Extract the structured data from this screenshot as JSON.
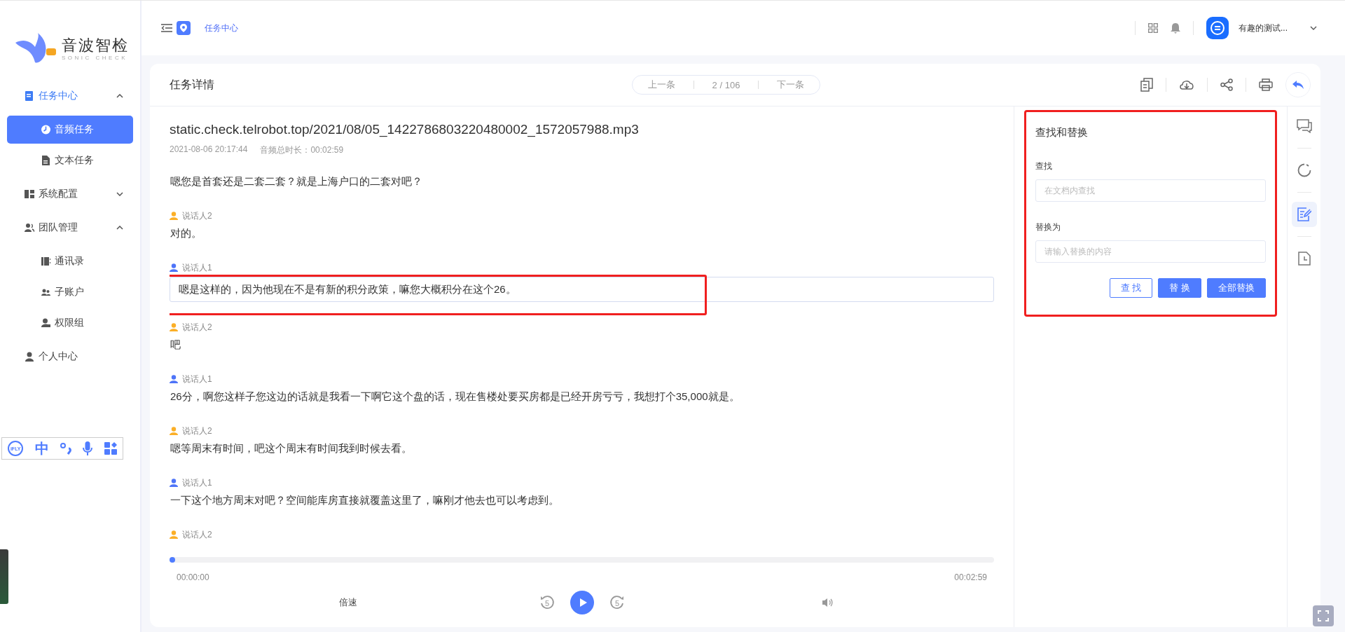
{
  "sidebar": {
    "logo": {
      "name": "音波智检",
      "tagline": "SONIC CHECK"
    },
    "menu": [
      {
        "label": "任务中心",
        "expanded": true,
        "children": [
          {
            "label": "音频任务",
            "selected": true
          },
          {
            "label": "文本任务",
            "selected": false
          }
        ]
      },
      {
        "label": "系统配置",
        "expanded": false
      },
      {
        "label": "团队管理",
        "expanded": true,
        "children": [
          {
            "label": "通讯录",
            "selected": false
          },
          {
            "label": "子账户",
            "selected": false
          },
          {
            "label": "权限组",
            "selected": false
          }
        ]
      },
      {
        "label": "个人中心"
      }
    ]
  },
  "ime_toolbar": {
    "logo": "iFLY",
    "mode": "中"
  },
  "header": {
    "breadcrumb": "任务中心",
    "user": "有趣的测试..."
  },
  "card": {
    "title": "任务详情",
    "pager": {
      "prev": "上一条",
      "position": "2 / 106",
      "next": "下一条"
    }
  },
  "file": {
    "name": "static.check.telrobot.top/2021/08/05_1422786803220480002_1572057988.mp3",
    "date": "2021-08-06 20:17:44",
    "duration": "音频总时长：00:02:59"
  },
  "segments": [
    {
      "text": "嗯您是首套还是二套二套？就是上海户口的二套对吧？",
      "selected": false
    },
    {
      "speaker": "说话人2",
      "color": "#fbaf27",
      "text": "对的。",
      "selected": false
    },
    {
      "speaker": "说话人1",
      "color": "#4e74f8",
      "text": "嗯是这样的，因为他现在不是有新的积分政策，嘛您大概积分在这个26。",
      "selected": true,
      "annotated": true
    },
    {
      "speaker": "说话人2",
      "color": "#fbaf27",
      "text": "吧",
      "selected": false
    },
    {
      "speaker": "说话人1",
      "color": "#4e74f8",
      "text": "26分，啊您这样子您这边的话就是我看一下啊它这个盘的话，现在售楼处要买房都是已经开房亏亏，我想打个35,000就是。",
      "selected": false
    },
    {
      "speaker": "说话人2",
      "color": "#fbaf27",
      "text": "嗯等周末有时间，吧这个周末有时间我到时候去看。",
      "selected": false
    },
    {
      "speaker": "说话人1",
      "color": "#4e74f8",
      "text": "一下这个地方周末对吧？空间能库房直接就覆盖这里了，嘛刚才他去也可以考虑到。",
      "selected": false
    },
    {
      "speaker": "说话人2",
      "color": "#fbaf27"
    }
  ],
  "player": {
    "level": 0,
    "current": "00:00:00",
    "total": "00:02:59",
    "speed": "倍速",
    "skip_back": "5",
    "skip_forward": "5"
  },
  "find_replace": {
    "annotated": true,
    "title": "查找和替换",
    "find_label": "查找",
    "find_placeholder": "在文档内查找",
    "replace_label": "替换为",
    "replace_placeholder": "请输入替换的内容",
    "buttons": [
      {
        "label": "查 找",
        "kind": "outline"
      },
      {
        "label": "替 换",
        "kind": "primary"
      },
      {
        "label": "全部替换",
        "kind": "primary"
      }
    ]
  },
  "side_tools": [
    {
      "selected": false
    },
    {
      "selected": false
    },
    {
      "selected": true
    },
    {
      "selected": false
    }
  ]
}
